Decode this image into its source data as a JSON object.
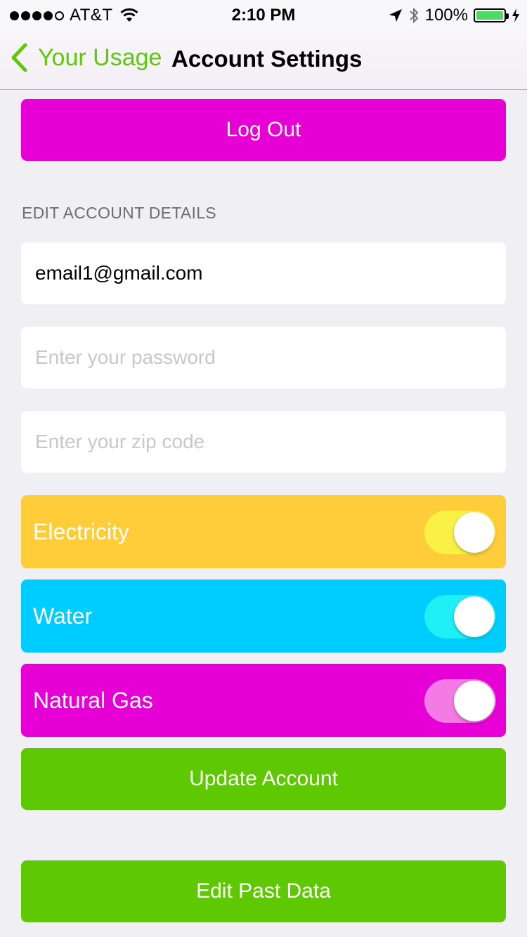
{
  "status_bar": {
    "carrier": "AT&T",
    "time": "2:10 PM",
    "battery": "100%",
    "battery_level": 1.0,
    "signal_bars_filled": 4,
    "signal_bars_total": 5
  },
  "nav": {
    "back_label": "Your Usage",
    "title": "Account Settings"
  },
  "buttons": {
    "logout": "Log Out",
    "update": "Update Account",
    "edit_past": "Edit Past Data"
  },
  "section": {
    "header": "EDIT ACCOUNT DETAILS"
  },
  "fields": {
    "email_value": "email1@gmail.com",
    "password_placeholder": "Enter your password",
    "zip_placeholder": "Enter your zip code"
  },
  "toggles": [
    {
      "label": "Electricity",
      "on": true,
      "color": "#ffcd3a"
    },
    {
      "label": "Water",
      "on": true,
      "color": "#00cdff"
    },
    {
      "label": "Natural Gas",
      "on": true,
      "color": "#e600d5"
    }
  ],
  "colors": {
    "accent_green": "#5ec902",
    "magenta": "#e600d5",
    "background": "#efeff4"
  }
}
